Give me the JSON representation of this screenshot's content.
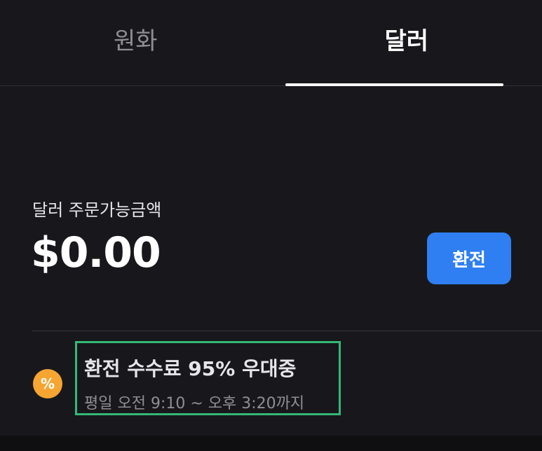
{
  "tabs": [
    {
      "label": "원화",
      "active": false
    },
    {
      "label": "달러",
      "active": true
    }
  ],
  "balance": {
    "label": "달러 주문가능금액",
    "amount": "$0.00"
  },
  "exchange_button": {
    "label": "환전"
  },
  "promo": {
    "icon_symbol": "%",
    "icon": "percent-icon",
    "title": "환전 수수료 95% 우대중",
    "subtitle": "평일 오전 9:10 ~ 오후 3:20까지"
  },
  "colors": {
    "background": "#18181c",
    "accent": "#2f7ff3",
    "promo_icon": "#f6a533",
    "highlight_border": "#35b877"
  }
}
